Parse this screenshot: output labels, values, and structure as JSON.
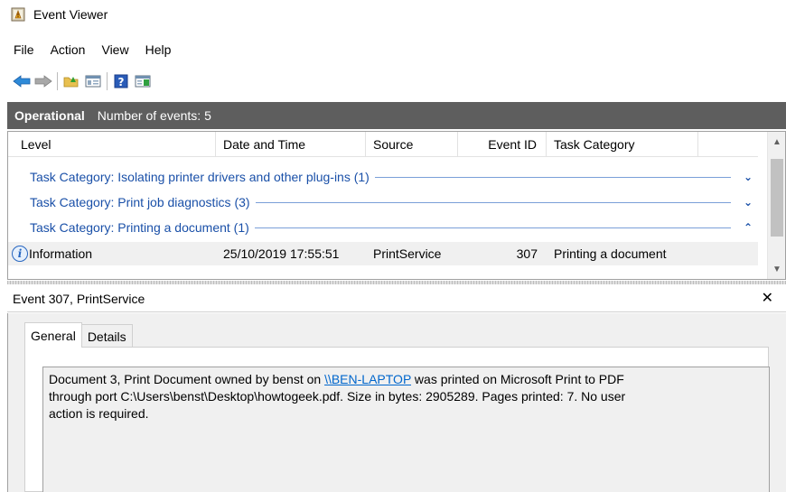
{
  "window": {
    "title": "Event Viewer"
  },
  "menu": [
    "File",
    "Action",
    "View",
    "Help"
  ],
  "toolbar": {
    "icons": [
      "back-arrow-icon",
      "forward-arrow-icon",
      "open-folder-icon",
      "console-tree-icon",
      "help-icon",
      "action-pane-icon"
    ]
  },
  "log_header": {
    "title": "Operational",
    "count_text": "Number of events: 5"
  },
  "columns": {
    "level": "Level",
    "date_time": "Date and Time",
    "source": "Source",
    "event_id": "Event ID",
    "task_category": "Task Category"
  },
  "groups": [
    {
      "label": "Task Category: Isolating printer drivers and other plug-ins (1)",
      "expanded": false
    },
    {
      "label": "Task Category: Print job diagnostics (3)",
      "expanded": false
    },
    {
      "label": "Task Category: Printing a document (1)",
      "expanded": true
    }
  ],
  "event_row": {
    "level": "Information",
    "date_time": "25/10/2019 17:55:51",
    "source": "PrintService",
    "event_id": "307",
    "task_category": "Printing a document"
  },
  "detail": {
    "header": "Event 307, PrintService",
    "tabs": [
      "General",
      "Details"
    ],
    "active_tab": "General",
    "description_before": "Document 3, Print Document owned by benst on ",
    "description_link": "\\\\BEN-LAPTOP",
    "description_line1_after": " was printed on Microsoft Print to PDF",
    "description_line2": "through port C:\\Users\\benst\\Desktop\\howtogeek.pdf. Size in bytes: 2905289. Pages printed: 7. No user",
    "description_line3": "action is required."
  },
  "colors": {
    "header_bar": "#5e5e5e",
    "group_text": "#1a50a8",
    "link": "#0066cc",
    "selected_row": "#f0f0f0"
  }
}
